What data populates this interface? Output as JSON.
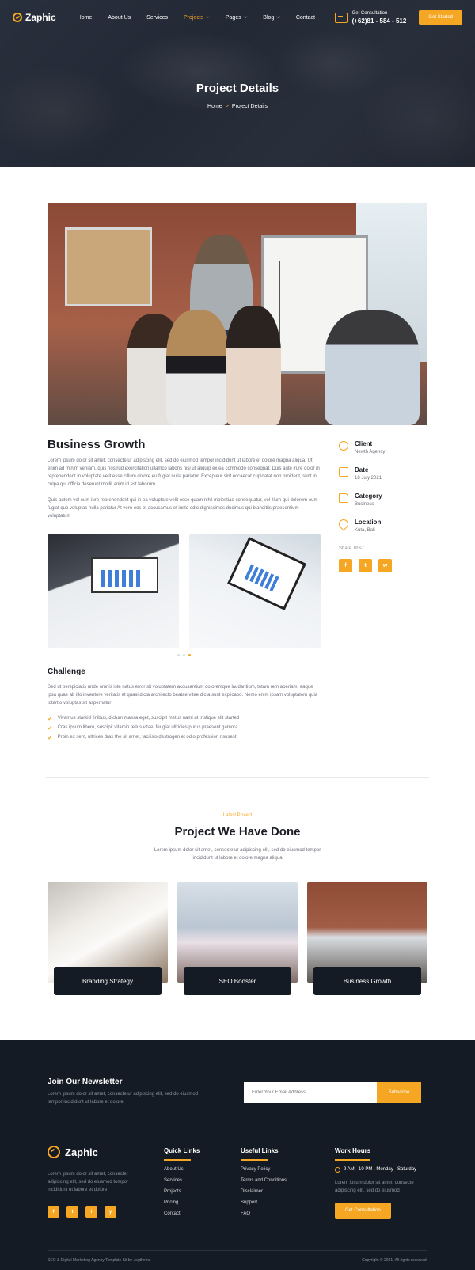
{
  "header": {
    "brand": "Zaphic",
    "menu": [
      {
        "label": "Home",
        "dropdown": false,
        "active": false
      },
      {
        "label": "About Us",
        "dropdown": false,
        "active": false
      },
      {
        "label": "Services",
        "dropdown": false,
        "active": false
      },
      {
        "label": "Projects",
        "dropdown": true,
        "active": true
      },
      {
        "label": "Pages",
        "dropdown": true,
        "active": false
      },
      {
        "label": "Blog",
        "dropdown": true,
        "active": false
      },
      {
        "label": "Contact",
        "dropdown": false,
        "active": false
      }
    ],
    "consult_label": "Get Consultation",
    "phone": "(+62)81 - 584 - 512",
    "cta": "Get Started"
  },
  "hero": {
    "title": "Project Details",
    "breadcrumb_home": "Home",
    "breadcrumb_sep": ">",
    "breadcrumb_current": "Project Details"
  },
  "project": {
    "title": "Business Growth",
    "para1": "Lorem ipsum dolor sit amet, consectetur adipiscing elit, sed do eiusmod tempor incididunt ut labore et dolore magna aliqua. Ut enim ad minim veniam, quis nostrud exercitation ullamco laboris nisi ut aliquip ex ea commodo consequat. Duis aute irure dolor in reprehenderit in voluptate velit esse cillum dolore eu fugiat nulla pariatur. Excepteur sint occaecat cupidatat non proident, sunt in culpa qui officia deserunt mollit anim id est laborum.",
    "para2": "Quis autem vel eum iure reprehenderit qui in ea voluptate velit esse quam nihil molestiae consequatur, vel illum qui dolorem eum fugiat quo voluptas nulla pariatur At vero eos et accusamus et iusto odio dignissimos ducimus qui blanditiis praesentium voluptatum"
  },
  "meta": {
    "client_label": "Client",
    "client_value": "Newth Agency",
    "date_label": "Date",
    "date_value": "18 July 2021",
    "category_label": "Category",
    "category_value": "Business",
    "location_label": "Location",
    "location_value": "Kuta, Bali",
    "share_label": "Share This :",
    "socials": [
      "f",
      "t",
      "w"
    ]
  },
  "challenge": {
    "title": "Challenge",
    "text": "Sed ut perspiciatis unde omnis iste natus error sit voluptatem accusantium doloremque laudantium, totam rem aperiam, eaque ipsa quae ab illo inventore veritatis et quasi dicta architecto beatae vitae dicta sunt explicabo. Nemo enim ipsam voluptatem quia totartio voluptas sit aspernatur",
    "checks": [
      "Vivamus starkid finibus, dictum massa eget, suscipit metus nami at tristique elit started",
      "Cras ipsum libero, suscipit vitamin tellus vitae, feugiat ultricies purus praesent gamora.",
      "Proin ex sem, ultrices drax the sit amet, facilisis destrogen et odio profession risusest"
    ]
  },
  "projects": {
    "kicker": "Latest Project",
    "title": "Project We Have Done",
    "subtitle": "Lorem ipsum dolor sit amet, consectetur adipiscing elit, sed do eiusmod tempor incididunt ut labore et dolore magna aliqua",
    "cards": [
      "Branding Strategy",
      "SEO Booster",
      "Business Growth"
    ]
  },
  "footer": {
    "newsletter_title": "Join Our Newsletter",
    "newsletter_text": "Lorem ipsum dolor sit amet, consectetur adipiscing elit, sed do eiusmod tempor incididunt ut labore et dolore",
    "email_placeholder": "Enter Your Email Address",
    "subscribe": "Subscribe",
    "brand": "Zaphic",
    "about": "Lorem ipsum dolor sit amet, consectet adipiscing elit, sed do eiusmod tempor incididunt ut labore et dolore",
    "socials": [
      "f",
      "t",
      "i",
      "y"
    ],
    "quick_links_title": "Quick Links",
    "quick_links": [
      "About Us",
      "Services",
      "Projects",
      "Pricing",
      "Contact"
    ],
    "useful_links_title": "Useful Links",
    "useful_links": [
      "Privacy Policy",
      "Terms and Conditions",
      "Disclaimer",
      "Support",
      "FAQ"
    ],
    "work_hours_title": "Work Hours",
    "hours": "9 AM - 10 PM , Monday - Saturday",
    "work_desc": "Lorem ipsum dolor sit amet, consecte adipiscing elit, sed do eiusmod",
    "work_cta": "Get Consultation",
    "copyright_left": "SEO & Digital Marketing Agency Template Kit by Jegtheme",
    "copyright_right": "Copyright © 2021. All rights reserved."
  },
  "colors": {
    "accent": "#f5a623",
    "dark": "#151b24",
    "text": "#1a1d24",
    "muted": "#6b6f78"
  }
}
